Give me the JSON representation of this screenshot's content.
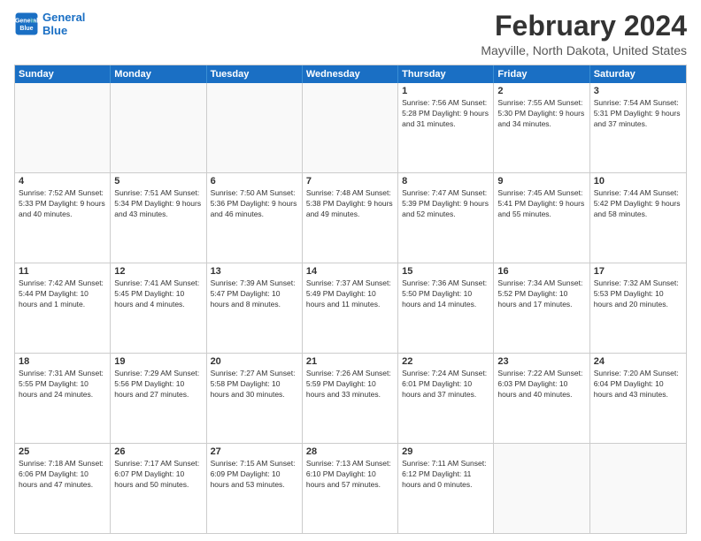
{
  "logo": {
    "line1": "General",
    "line2": "Blue"
  },
  "title": "February 2024",
  "subtitle": "Mayville, North Dakota, United States",
  "days_of_week": [
    "Sunday",
    "Monday",
    "Tuesday",
    "Wednesday",
    "Thursday",
    "Friday",
    "Saturday"
  ],
  "weeks": [
    [
      {
        "day": "",
        "empty": true
      },
      {
        "day": "",
        "empty": true
      },
      {
        "day": "",
        "empty": true
      },
      {
        "day": "",
        "empty": true
      },
      {
        "day": "1",
        "info": "Sunrise: 7:56 AM\nSunset: 5:28 PM\nDaylight: 9 hours\nand 31 minutes."
      },
      {
        "day": "2",
        "info": "Sunrise: 7:55 AM\nSunset: 5:30 PM\nDaylight: 9 hours\nand 34 minutes."
      },
      {
        "day": "3",
        "info": "Sunrise: 7:54 AM\nSunset: 5:31 PM\nDaylight: 9 hours\nand 37 minutes."
      }
    ],
    [
      {
        "day": "4",
        "info": "Sunrise: 7:52 AM\nSunset: 5:33 PM\nDaylight: 9 hours\nand 40 minutes."
      },
      {
        "day": "5",
        "info": "Sunrise: 7:51 AM\nSunset: 5:34 PM\nDaylight: 9 hours\nand 43 minutes."
      },
      {
        "day": "6",
        "info": "Sunrise: 7:50 AM\nSunset: 5:36 PM\nDaylight: 9 hours\nand 46 minutes."
      },
      {
        "day": "7",
        "info": "Sunrise: 7:48 AM\nSunset: 5:38 PM\nDaylight: 9 hours\nand 49 minutes."
      },
      {
        "day": "8",
        "info": "Sunrise: 7:47 AM\nSunset: 5:39 PM\nDaylight: 9 hours\nand 52 minutes."
      },
      {
        "day": "9",
        "info": "Sunrise: 7:45 AM\nSunset: 5:41 PM\nDaylight: 9 hours\nand 55 minutes."
      },
      {
        "day": "10",
        "info": "Sunrise: 7:44 AM\nSunset: 5:42 PM\nDaylight: 9 hours\nand 58 minutes."
      }
    ],
    [
      {
        "day": "11",
        "info": "Sunrise: 7:42 AM\nSunset: 5:44 PM\nDaylight: 10 hours\nand 1 minute."
      },
      {
        "day": "12",
        "info": "Sunrise: 7:41 AM\nSunset: 5:45 PM\nDaylight: 10 hours\nand 4 minutes."
      },
      {
        "day": "13",
        "info": "Sunrise: 7:39 AM\nSunset: 5:47 PM\nDaylight: 10 hours\nand 8 minutes."
      },
      {
        "day": "14",
        "info": "Sunrise: 7:37 AM\nSunset: 5:49 PM\nDaylight: 10 hours\nand 11 minutes."
      },
      {
        "day": "15",
        "info": "Sunrise: 7:36 AM\nSunset: 5:50 PM\nDaylight: 10 hours\nand 14 minutes."
      },
      {
        "day": "16",
        "info": "Sunrise: 7:34 AM\nSunset: 5:52 PM\nDaylight: 10 hours\nand 17 minutes."
      },
      {
        "day": "17",
        "info": "Sunrise: 7:32 AM\nSunset: 5:53 PM\nDaylight: 10 hours\nand 20 minutes."
      }
    ],
    [
      {
        "day": "18",
        "info": "Sunrise: 7:31 AM\nSunset: 5:55 PM\nDaylight: 10 hours\nand 24 minutes."
      },
      {
        "day": "19",
        "info": "Sunrise: 7:29 AM\nSunset: 5:56 PM\nDaylight: 10 hours\nand 27 minutes."
      },
      {
        "day": "20",
        "info": "Sunrise: 7:27 AM\nSunset: 5:58 PM\nDaylight: 10 hours\nand 30 minutes."
      },
      {
        "day": "21",
        "info": "Sunrise: 7:26 AM\nSunset: 5:59 PM\nDaylight: 10 hours\nand 33 minutes."
      },
      {
        "day": "22",
        "info": "Sunrise: 7:24 AM\nSunset: 6:01 PM\nDaylight: 10 hours\nand 37 minutes."
      },
      {
        "day": "23",
        "info": "Sunrise: 7:22 AM\nSunset: 6:03 PM\nDaylight: 10 hours\nand 40 minutes."
      },
      {
        "day": "24",
        "info": "Sunrise: 7:20 AM\nSunset: 6:04 PM\nDaylight: 10 hours\nand 43 minutes."
      }
    ],
    [
      {
        "day": "25",
        "info": "Sunrise: 7:18 AM\nSunset: 6:06 PM\nDaylight: 10 hours\nand 47 minutes."
      },
      {
        "day": "26",
        "info": "Sunrise: 7:17 AM\nSunset: 6:07 PM\nDaylight: 10 hours\nand 50 minutes."
      },
      {
        "day": "27",
        "info": "Sunrise: 7:15 AM\nSunset: 6:09 PM\nDaylight: 10 hours\nand 53 minutes."
      },
      {
        "day": "28",
        "info": "Sunrise: 7:13 AM\nSunset: 6:10 PM\nDaylight: 10 hours\nand 57 minutes."
      },
      {
        "day": "29",
        "info": "Sunrise: 7:11 AM\nSunset: 6:12 PM\nDaylight: 11 hours\nand 0 minutes."
      },
      {
        "day": "",
        "empty": true
      },
      {
        "day": "",
        "empty": true
      }
    ]
  ]
}
